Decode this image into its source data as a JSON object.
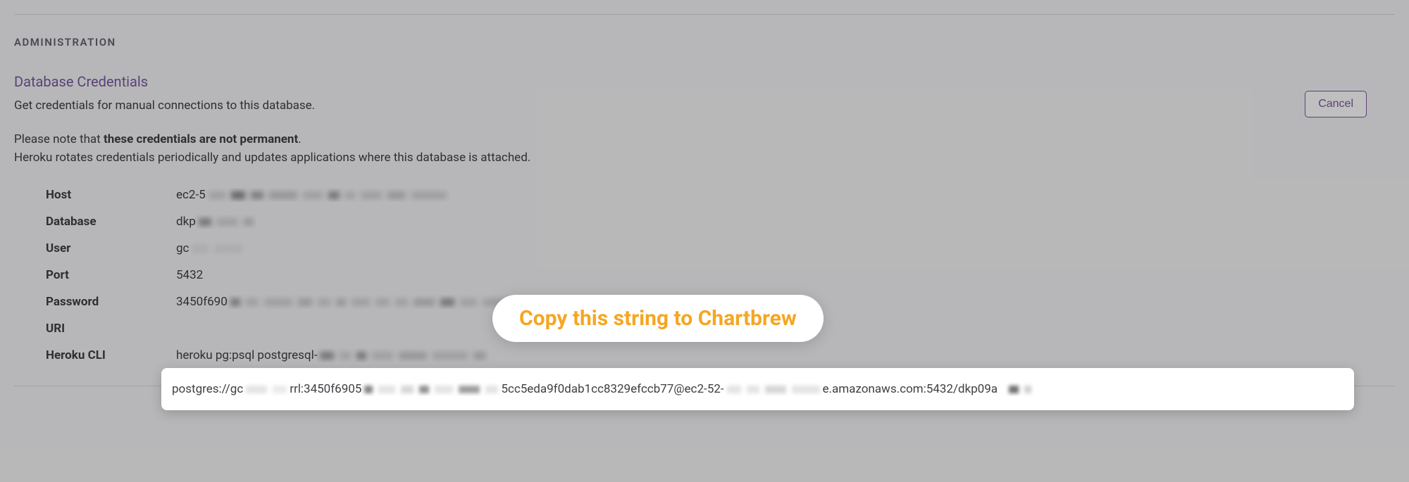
{
  "section_header": "ADMINISTRATION",
  "subsection_title": "Database Credentials",
  "description": "Get credentials for manual connections to this database.",
  "note_prefix": "Please note that ",
  "note_bold": "these credentials are not permanent",
  "note_suffix": ".",
  "note_line2": "Heroku rotates credentials periodically and updates applications where this database is attached.",
  "cancel_label": "Cancel",
  "tooltip_text": "Copy this string to Chartbrew",
  "credentials": {
    "host": {
      "label": "Host",
      "value_visible": "ec2-5"
    },
    "database": {
      "label": "Database",
      "value_visible": "dkp"
    },
    "user": {
      "label": "User",
      "value_visible": "gc"
    },
    "port": {
      "label": "Port",
      "value": "5432"
    },
    "password": {
      "label": "Password",
      "value_visible": "3450f690"
    },
    "uri": {
      "label": "URI",
      "value_prefix": "postgres://gc",
      "value_mid1": "rrl:3450f6905",
      "value_mid2": "5cc5eda9f0dab1cc8329efccb77@ec2-52-",
      "value_suffix": "e.amazonaws.com:5432/dkp09a"
    },
    "heroku_cli": {
      "label": "Heroku CLI",
      "value_visible": "heroku pg:psql postgresql-"
    }
  }
}
